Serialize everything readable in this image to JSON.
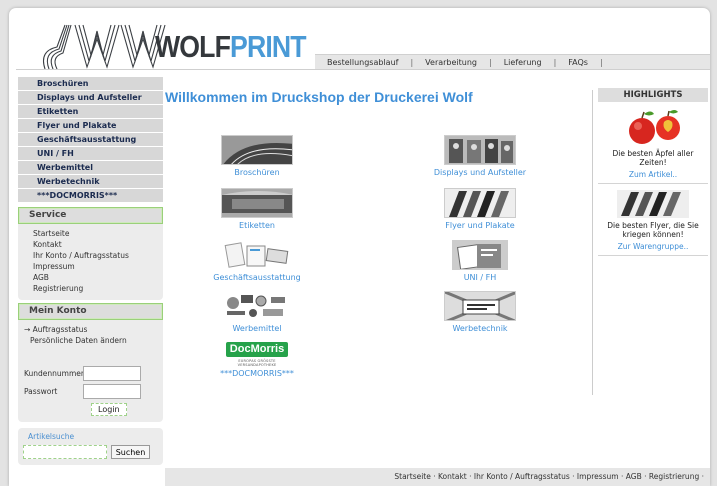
{
  "header": {
    "brand_part1": "WOLF",
    "brand_part2": "PRINT",
    "nav": [
      "Bestellungsablauf",
      "Verarbeitung",
      "Lieferung",
      "FAQs"
    ]
  },
  "categories": [
    "Broschüren",
    "Displays und Aufsteller",
    "Etiketten",
    "Flyer und Plakate",
    "Geschäftsausstattung",
    "UNI / FH",
    "Werbemittel",
    "Werbetechnik",
    "***DOCMORRIS***"
  ],
  "service": {
    "title": "Service",
    "items": [
      "Startseite",
      "Kontakt",
      "Ihr Konto / Auftragsstatus",
      "Impressum",
      "AGB",
      "Registrierung"
    ]
  },
  "account": {
    "title": "Mein Konto",
    "items": [
      "Auftragsstatus",
      "Persönliche Daten ändern"
    ],
    "customer_label": "Kundennummer",
    "password_label": "Passwort",
    "login_label": "Login"
  },
  "search": {
    "label": "Artikelsuche",
    "button": "Suchen"
  },
  "main": {
    "welcome": "Willkommen im Druckshop der Druckerei Wolf",
    "tiles": [
      "Broschüren",
      "Displays und Aufsteller",
      "Etiketten",
      "Flyer und Plakate",
      "Geschäftsausstattung",
      "UNI / FH",
      "Werbemittel",
      "Werbetechnik",
      "***DOCMORRIS***"
    ],
    "docmorris_logo": "DocMorris",
    "docmorris_tagline": "EUROPAS GRÖSSTE VERSANDAPOTHEKE"
  },
  "highlights": {
    "title": "HIGHLIGHTS",
    "item1_text": "Die besten Äpfel aller Zeiten!",
    "item1_link": "Zum Artikel..",
    "item2_text": "Die besten Flyer, die Sie kriegen können!",
    "item2_link": "Zur Warengruppe.."
  },
  "footer": [
    "Startseite",
    "Kontakt",
    "Ihr Konto / Auftragsstatus",
    "Impressum",
    "AGB",
    "Registrierung"
  ]
}
